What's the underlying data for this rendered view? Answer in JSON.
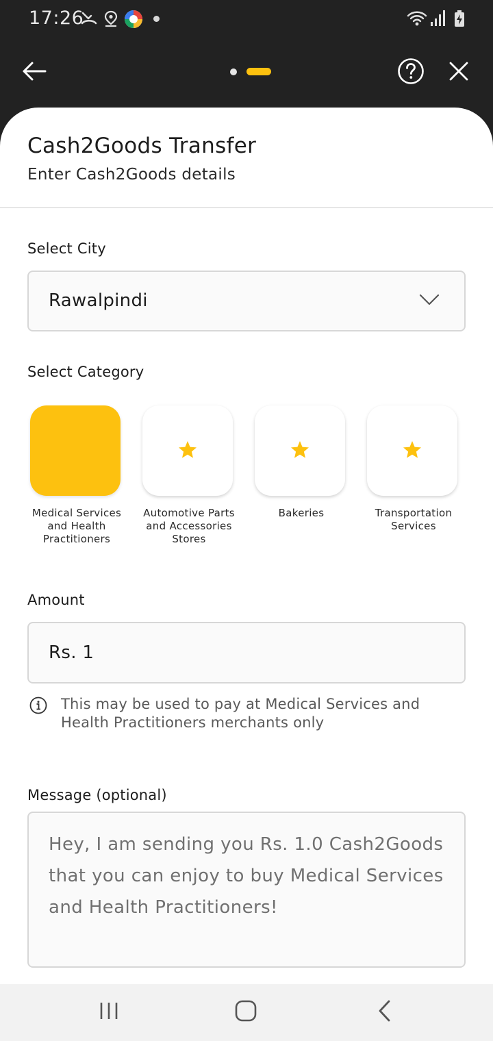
{
  "status_bar": {
    "time": "17:26",
    "icons": [
      "missed-call-icon",
      "location-icon",
      "app-notification-icon",
      "notification-dot",
      "wifi-icon",
      "signal-icon",
      "battery-charging-icon"
    ]
  },
  "top_bar": {
    "back_icon": "arrow-left-icon",
    "help_icon": "question-circle-icon",
    "close_icon": "close-icon",
    "steps_total": 2,
    "step_current": 2
  },
  "header": {
    "title": "Cash2Goods Transfer",
    "subtitle": "Enter Cash2Goods details"
  },
  "city": {
    "label": "Select City",
    "value": "Rawalpindi"
  },
  "category": {
    "label": "Select Category",
    "items": [
      {
        "label": "Medical Services and Health Practitioners",
        "selected": true,
        "icon": "none"
      },
      {
        "label": "Automotive Parts and Accessories Stores",
        "selected": false,
        "icon": "star-icon"
      },
      {
        "label": "Bakeries",
        "selected": false,
        "icon": "star-icon"
      },
      {
        "label": "Transportation Services",
        "selected": false,
        "icon": "star-icon"
      }
    ]
  },
  "amount": {
    "label": "Amount",
    "value": "Rs. 1",
    "info": "This may be used to pay at Medical Services and Health Practitioners merchants only"
  },
  "message": {
    "label": "Message (optional)",
    "placeholder": "Hey, I am sending you Rs. 1.0 Cash2Goods that you can enjoy to buy Medical Services and Health Practitioners!"
  },
  "colors": {
    "accent": "#FDC10F",
    "dark_bg": "#222222",
    "surface": "#FFFFFF"
  }
}
